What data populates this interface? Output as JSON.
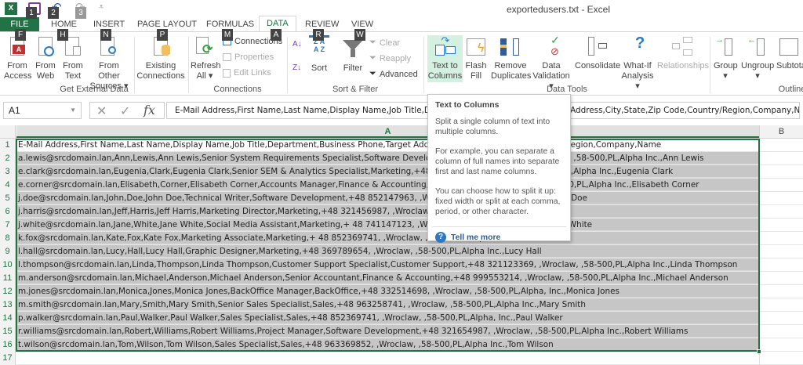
{
  "window": {
    "title": "exportedusers.txt - Excel"
  },
  "qat": {
    "keys": [
      "1",
      "2",
      "3"
    ]
  },
  "tabs": [
    {
      "label": "FILE",
      "key": "F"
    },
    {
      "label": "HOME",
      "key": "H"
    },
    {
      "label": "INSERT",
      "key": "N"
    },
    {
      "label": "PAGE LAYOUT",
      "key": "P"
    },
    {
      "label": "FORMULAS",
      "key": "M"
    },
    {
      "label": "DATA",
      "key": "A"
    },
    {
      "label": "REVIEW",
      "key": "R"
    },
    {
      "label": "VIEW",
      "key": "W"
    }
  ],
  "ribbon": {
    "get_external": {
      "group": "Get External Data",
      "from_access": [
        "From",
        "Access"
      ],
      "from_web": [
        "From",
        "Web"
      ],
      "from_text": [
        "From",
        "Text"
      ],
      "from_other": [
        "From Other",
        "Sources ▾"
      ],
      "existing": [
        "Existing",
        "Connections"
      ]
    },
    "connections": {
      "group": "Connections",
      "refresh": [
        "Refresh",
        "All ▾"
      ],
      "connections": "Connections",
      "properties": "Properties",
      "edit_links": "Edit Links"
    },
    "sort_filter": {
      "group": "Sort & Filter",
      "sort": "Sort",
      "filter": "Filter",
      "clear": "Clear",
      "reapply": "Reapply",
      "advanced": "Advanced"
    },
    "data_tools": {
      "group": "Data Tools",
      "text_to_columns": [
        "Text to",
        "Columns"
      ],
      "flash_fill": [
        "Flash",
        "Fill"
      ],
      "remove_dup": [
        "Remove",
        "Duplicates"
      ],
      "validation": [
        "Data",
        "Validation ▾"
      ],
      "consolidate": "Consolidate",
      "whatif": [
        "What-If",
        "Analysis ▾"
      ],
      "relationships": "Relationships"
    },
    "outline": {
      "group": "Outline",
      "group_btn": [
        "Group",
        "▾"
      ],
      "ungroup": [
        "Ungroup",
        "▾"
      ],
      "subtotal": "Subtota"
    }
  },
  "formula_bar": {
    "name_box": "A1",
    "fx": "fx",
    "value": "E-Mail Address,First Name,Last Name,Display Name,Job Title,Department,Business Phone,Target Address,City,State,Zip Code,Country/Region,Company,Name"
  },
  "columns": [
    "A",
    "B"
  ],
  "rows": [
    {
      "n": "1",
      "a": "E-Mail Address,First Name,Last Name,Display Name,Job Title,Department,Business Phone,Target Address,City,State,Zip Code,Country/Region,Company,Name"
    },
    {
      "n": "2",
      "a": "a.lewis@srcdomain.lan,Ann,Lewis,Ann Lewis,Senior System Requirements Specialist,Software Development,+48 123456789, ,Wroclaw, ,58-500,PL,Alpha Inc.,Ann Lewis"
    },
    {
      "n": "3",
      "a": "e.clark@srcdomain.lan,Eugenia,Clark,Eugenia Clark,Senior SEM & Analytics Specialist,Marketing,+48 123456789, ,Wroclaw, ,58-500,PL,Alpha Inc.,Eugenia Clark"
    },
    {
      "n": "4",
      "a": "e.corner@srcdomain.lan,Elisabeth,Corner,Elisabeth Corner,Accounts Manager,Finance & Accounting,+48 123456789, ,Wroclaw, ,58-500,PL,Alpha Inc.,Elisabeth Corner"
    },
    {
      "n": "5",
      "a": "j.doe@srcdomain.lan,John,Doe,John Doe,Technical Writer,Software Development,+48 852147963, ,Wroclaw, ,58-500,PL,Alpha Inc.,John Doe"
    },
    {
      "n": "6",
      "a": "j.harris@srcdomain.lan,Jeff,Harris,Jeff Harris,Marketing Director,Marketing,+48 321456987, ,Wroclaw, ,58-500,PL,Alpha Inc.,Jeff Harris"
    },
    {
      "n": "7",
      "a": "j.white@srcdomain.lan,Jane,White,Jane White,Social Media Assistant,Marketing,+ 48 741147123, ,Wroclaw, ,58-500,PL,Alpha Inc.,Jane White"
    },
    {
      "n": "8",
      "a": "k.fox@srcdomain.lan,Kate,Fox,Kate Fox,Marketing Associate,Marketing,+ 48 852369741, ,Wroclaw, ,58-500,PL,Alpha,Kate Fox"
    },
    {
      "n": "9",
      "a": "l.hall@srcdomain.lan,Lucy,Hall,Lucy Hall,Graphic Designer,Marketing,+48 369789654, ,Wroclaw, ,58-500,PL,Alpha Inc.,Lucy Hall"
    },
    {
      "n": "10",
      "a": "l.thompson@srcdomain.lan,Linda,Thompson,Linda Thompson,Customer Support Specialist,Customer Support,+48 321123369, ,Wroclaw, ,58-500,PL,Alpha Inc.,Linda Thompson"
    },
    {
      "n": "11",
      "a": "m.anderson@srcdomain.lan,Michael,Anderson,Michael Anderson,Senior Accountant,Finance & Accounting,+48 999553214, ,Wroclaw, ,58-500,PL,Alpha Inc.,Michael Anderson"
    },
    {
      "n": "12",
      "a": "m.jones@srcdomain.lan,Monica,Jones,Monica Jones,BackOffice Manager,BackOffice,+48 332514698, ,Wroclaw, ,58-500,PL,Alpha, Inc.,Monica Jones"
    },
    {
      "n": "13",
      "a": "m.smith@srcdomain.lan,Mary,Smith,Mary Smith,Senior Sales Specialist,Sales,+48 963258741, ,Wroclaw, ,58-500,PL,Alpha Inc.,Mary Smith"
    },
    {
      "n": "14",
      "a": "p.walker@srcdomain.lan,Paul,Walker,Paul Walker,Sales Specialist,Sales,+48 852369741, ,Wroclaw, ,58-500,PL,Alpha, Inc.,Paul Walker"
    },
    {
      "n": "15",
      "a": "r.williams@srcdomain.lan,Robert,Williams,Robert Williams,Project Manager,Software Development,+48 321654987, ,Wroclaw, ,58-500,PL,Alpha Inc.,Robert Williams"
    },
    {
      "n": "16",
      "a": "t.wilson@srcdomain.lan,Tom,Wilson,Tom Wilson,Sales Specialist,Sales,+48 963369852, ,Wroclaw, ,58-500,PL,Alpha Inc.,Tom Wilson"
    },
    {
      "n": "17",
      "a": ""
    }
  ],
  "tooltip": {
    "title": "Text to Columns",
    "p1": "Split a single column of text into multiple columns.",
    "p2": "For example, you can separate a column of full names into separate first and last name columns.",
    "p3": "You can choose how to split it up: fixed width or split at each comma, period, or other character.",
    "link": "Tell me more"
  },
  "colors": {
    "accent": "#217346",
    "selection": "#c6c6c6"
  }
}
